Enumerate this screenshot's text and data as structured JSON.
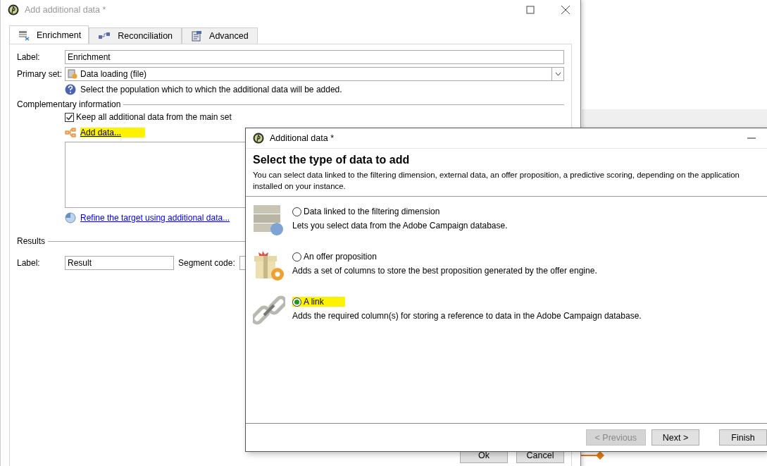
{
  "back_window": {
    "title": "Add additional data *",
    "tabs": [
      {
        "label": "Enrichment",
        "selected": true,
        "kind": "enrich"
      },
      {
        "label": "Reconciliation",
        "selected": false,
        "kind": "reconcile"
      },
      {
        "label": "Advanced",
        "selected": false,
        "kind": "advanced"
      }
    ],
    "label_caption": "Label:",
    "label_value": "Enrichment",
    "primary_set_caption": "Primary set:",
    "primary_set_value": "Data loading (file)",
    "help": "Select the population which to which the additional data will be added.",
    "complementary": {
      "heading": "Complementary information",
      "keep_all": {
        "label": "Keep all additional data from the main set",
        "checked": true
      },
      "add_data": {
        "label": "Add data...",
        "highlighted": true
      },
      "refine_link": "Refine the target using additional data..."
    },
    "results": {
      "heading": "Results",
      "label_caption": "Label:",
      "label_value": "Result",
      "segment_caption": "Segment code:"
    },
    "buttons": [
      "Ok",
      "Cancel"
    ]
  },
  "dialog": {
    "title": "Additional data *",
    "heading": "Select the type of data to add",
    "description": [
      "You can select data linked to the filtering dimension, external data, an offer proposition, a predictive scoring, depending on the application",
      "installed on your instance."
    ],
    "options": [
      {
        "kind": "database",
        "label": "Data linked to the filtering dimension",
        "description": "Lets you select data from the Adobe Campaign database.",
        "selected": false,
        "highlighted": false
      },
      {
        "kind": "offer",
        "label": "An offer proposition",
        "description": "Adds a set of columns to store the best proposition generated by the offer engine.",
        "selected": false,
        "highlighted": false
      },
      {
        "kind": "link",
        "label": "A link",
        "description": "Adds the required column(s) for storing a reference to data in the Adobe Campaign database.",
        "selected": true,
        "highlighted": true
      }
    ],
    "buttons": [
      {
        "label": "< Previous",
        "disabled": true
      },
      {
        "label": "Next >",
        "disabled": false
      },
      {
        "label": "Finish",
        "disabled": false
      }
    ]
  }
}
